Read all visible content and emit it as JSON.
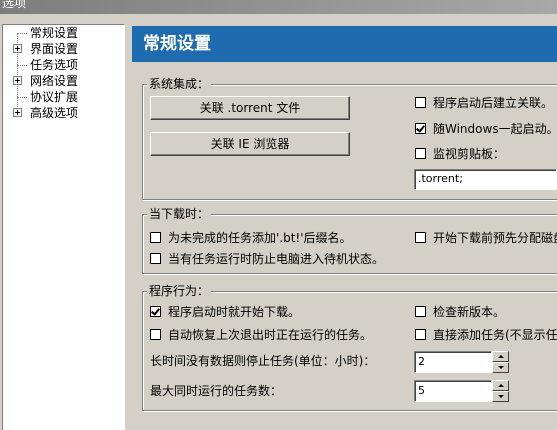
{
  "window": {
    "title": "选项"
  },
  "tree": {
    "items": [
      {
        "label": "常规设置",
        "expandable": false
      },
      {
        "label": "界面设置",
        "expandable": true
      },
      {
        "label": "任务选项",
        "expandable": false
      },
      {
        "label": "网络设置",
        "expandable": true
      },
      {
        "label": "协议扩展",
        "expandable": false
      },
      {
        "label": "高级选项",
        "expandable": true
      }
    ]
  },
  "header": {
    "title": "常规设置"
  },
  "system_integration": {
    "title": "系统集成：",
    "associate_torrent_button": "关联 .torrent 文件",
    "associate_ie_button": "关联 IE 浏览器",
    "create_association_on_start": {
      "label": "程序启动后建立关联。",
      "checked": false
    },
    "start_with_windows": {
      "label": "随Windows一起启动。",
      "checked": true
    },
    "monitor_clipboard": {
      "label": "监视剪贴板：",
      "checked": false
    },
    "clipboard_extensions": ".torrent;"
  },
  "current_download": {
    "title": "当下载时：",
    "add_bt_suffix": {
      "label": "为未完成的任务添加'.bt!'后缀名。",
      "checked": false
    },
    "preallocate_disk": {
      "label": "开始下载前预先分配磁盘",
      "checked": false
    },
    "prevent_standby": {
      "label": "当有任务运行时防止电脑进入待机状态。",
      "checked": false
    }
  },
  "program_behavior": {
    "title": "程序行为：",
    "start_download_on_launch": {
      "label": "程序启动时就开始下载。",
      "checked": true
    },
    "check_new_version": {
      "label": "检查新版本。",
      "checked": false
    },
    "auto_resume": {
      "label": "自动恢复上次退出时正在运行的任务。",
      "checked": false
    },
    "add_task_directly": {
      "label": "直接添加任务(不显示任",
      "checked": false
    },
    "idle_stop_label": "长时间没有数据则停止任务(单位：小时)：",
    "idle_stop_value": "2",
    "max_tasks_label": "最大同时运行的任务数：",
    "max_tasks_value": "5"
  }
}
